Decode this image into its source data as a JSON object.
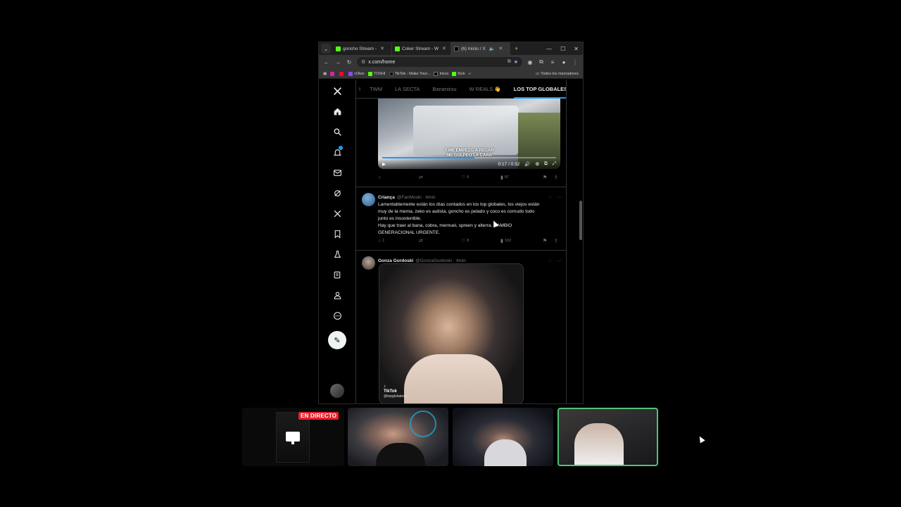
{
  "browser": {
    "tabs": [
      {
        "title": "goncho Stream - ",
        "favicon": "kick"
      },
      {
        "title": "Coker Stream - W",
        "favicon": "kick"
      },
      {
        "title": "(6) Inicio / X",
        "favicon": "x",
        "active": true
      }
    ],
    "url": "x.com/home",
    "bookmarks": [
      {
        "label": "",
        "color": "#d6249f"
      },
      {
        "label": "",
        "color": "#ff0033"
      },
      {
        "label": "cOker",
        "color": "#9146ff"
      },
      {
        "label": "TOSHI",
        "color": "#53fc18"
      },
      {
        "label": "TikTok - Make Your...",
        "color": "#111111"
      },
      {
        "label": "Inicio",
        "color": "#000000"
      },
      {
        "label": "Kick",
        "color": "#53fc18"
      }
    ],
    "bookmarks_overflow": "»",
    "bookmarks_all": "Todos los marcadores"
  },
  "x": {
    "list_tabs": [
      "I",
      "TWM",
      "LA SECTA",
      "Bananirou",
      "W REALS 👋",
      "LOS TOP GLOBALES ⌄"
    ],
    "active_tab_index": 5,
    "video_tweet": {
      "subtitle_line1": "Y ME EMPEZO A PEGAR",
      "subtitle_line2": "ME GOLPEO LA CARA",
      "time": "0:17 / 0:32",
      "progress": 0.53,
      "replies": "",
      "retweets": "",
      "likes": "6",
      "views": "87"
    },
    "tweet1": {
      "name": "Criança",
      "handle": "@FanMoski · 4min",
      "text_line1": "Lamentablemente están los días contados en los top globales, los viejos están",
      "text_line2": "muy de la mema, zeko es autista, goncho es pelado y coco es cornudo todo",
      "text_line3": "junto es insostenible.",
      "text_line4": "Hay que traer al bana, cobra, mernuel, spreen y alterra. CAMBIO",
      "text_line5": "GENERACIONAL URGENTE.",
      "replies": "1",
      "retweets": "",
      "likes": "8",
      "views": "102"
    },
    "tweet2": {
      "name": "Gonza Gordoski",
      "handle": "@GonzaGordoski · 4min",
      "media_label": "TikTok",
      "media_handle": "@topglobalese"
    }
  },
  "stream": {
    "live_badge": "EN DIRECTO",
    "active_cam_color": "#53c27a"
  }
}
